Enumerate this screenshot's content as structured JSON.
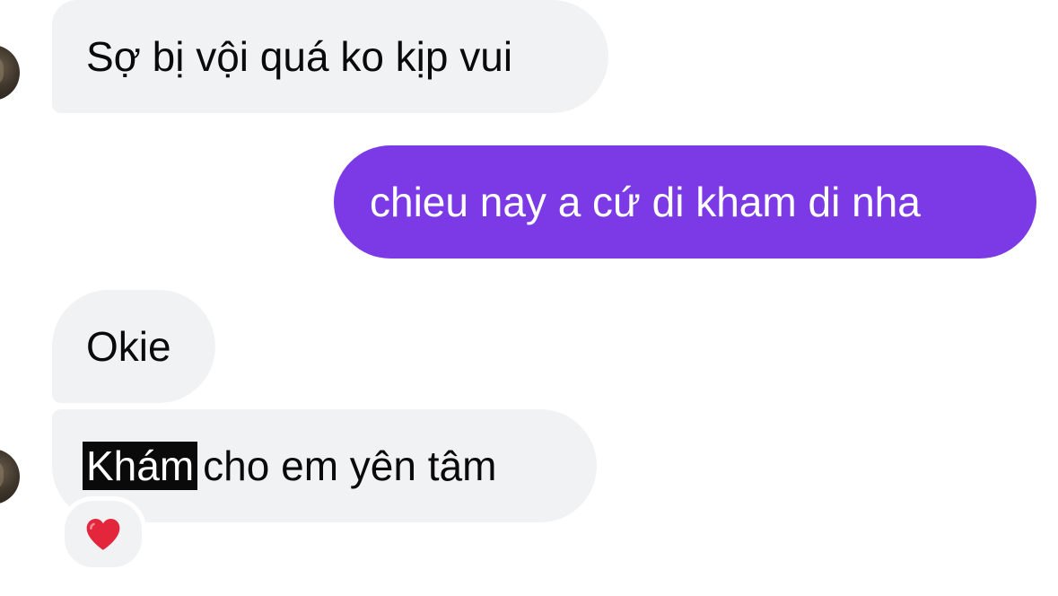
{
  "messages": [
    {
      "direction": "incoming",
      "text": "Sợ bị vội quá ko kịp vui"
    },
    {
      "direction": "outgoing",
      "text": "chieu nay a cứ di kham di nha"
    },
    {
      "direction": "incoming",
      "text": "Okie"
    },
    {
      "direction": "incoming",
      "highlighted_text": "Khám",
      "text": "cho em yên tâm",
      "reaction": "heart-emoji"
    }
  ],
  "colors": {
    "outgoing_bubble": "#7b3ae6",
    "incoming_bubble": "#f1f2f4",
    "highlight": "#0a0a0a",
    "heart": "#e3263c"
  }
}
